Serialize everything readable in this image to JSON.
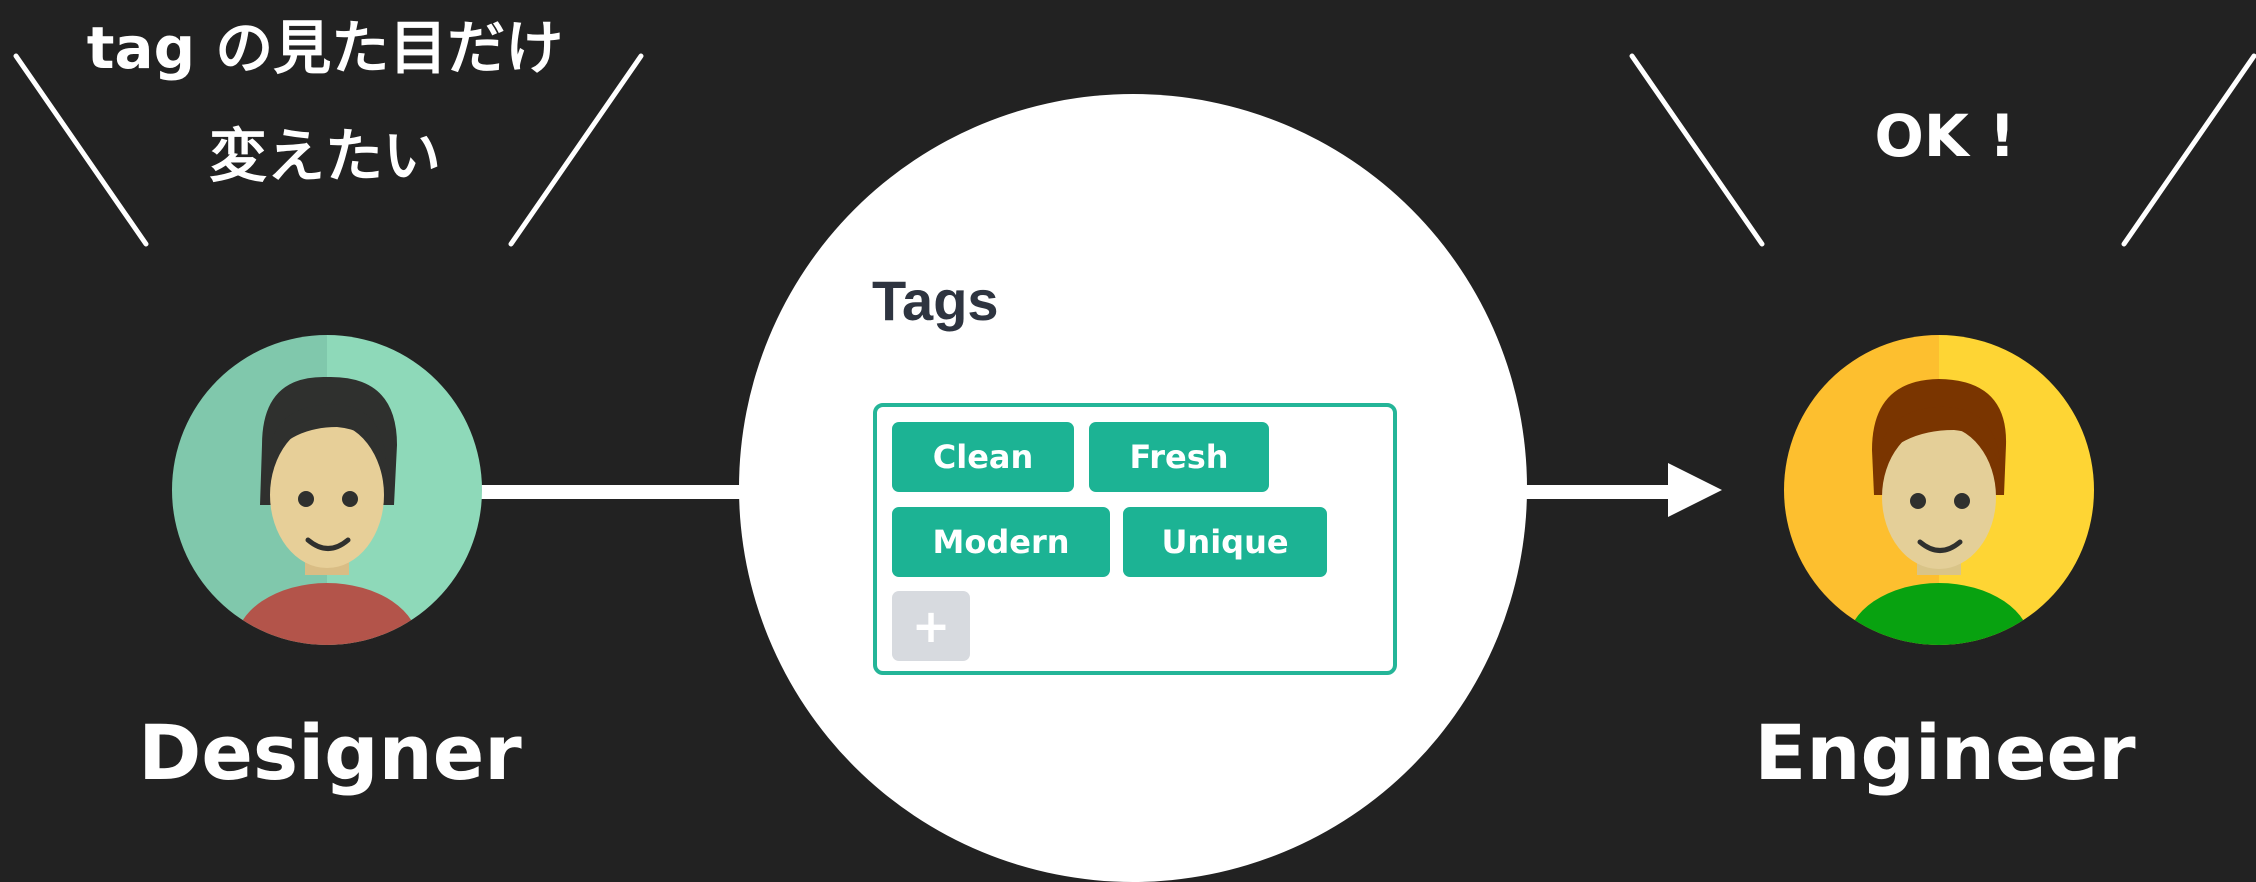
{
  "designer": {
    "speech_line1": "tag の見た目だけ",
    "speech_line2": "変えたい",
    "label": "Designer",
    "avatar_icon": "designer-avatar-icon",
    "colors": {
      "bg_left": "#80c8ac",
      "bg_right": "#8ed9b9",
      "hair": "#2f302e",
      "skin": "#e7cf98",
      "shirt": "#b3544a"
    }
  },
  "engineer": {
    "speech": "OK !",
    "label": "Engineer",
    "avatar_icon": "engineer-avatar-icon",
    "colors": {
      "bg_left": "#fdbf2f",
      "bg_right": "#fed534",
      "hair": "#7a3500",
      "skin": "#e4cf98",
      "shirt": "#08a210"
    }
  },
  "tags_widget": {
    "title": "Tags",
    "tags": [
      "Clean",
      "Fresh",
      "Modern",
      "Unique"
    ],
    "add_label": "+",
    "accent_color": "#1cb394",
    "add_button_color": "#d7dadf"
  },
  "flow": {
    "arrow_icon": "arrow-right-icon",
    "line_color": "#ffffff"
  },
  "background_color": "#222222"
}
